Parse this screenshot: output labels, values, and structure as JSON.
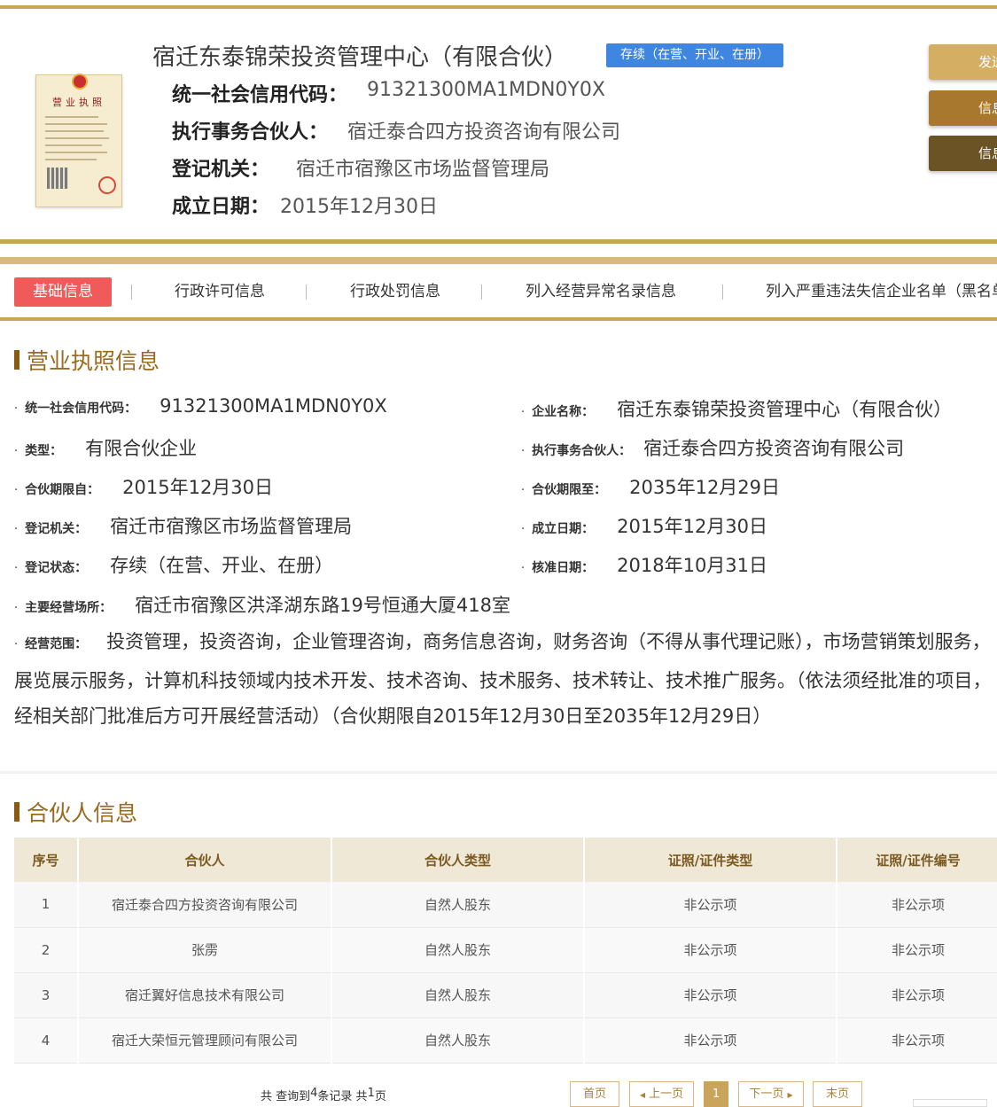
{
  "header": {
    "company_name": "宿迁东泰锦荣投资管理中心（有限合伙）",
    "status_tag": "存续（在营、开业、在册）",
    "rows": [
      {
        "key": "统一社会信用代码：",
        "value": "91321300MA1MDN0Y0X"
      },
      {
        "key": "执行事务合伙人：",
        "value": "宿迁泰合四方投资咨询有限公司"
      },
      {
        "key": "登记机关：",
        "value": "宿迁市宿豫区市场监督管理局"
      },
      {
        "key": "成立日期：",
        "value": "2015年12月30日"
      }
    ],
    "license_title": "营业执照",
    "side_buttons": [
      "发送",
      "信息",
      "信息"
    ],
    "side_colors": [
      "#d4ae63",
      "#a8782e",
      "#6b5326"
    ]
  },
  "tabs": {
    "active": "基础信息",
    "items": [
      "行政许可信息",
      "行政处罚信息",
      "列入经营异常名录信息",
      "列入严重违法失信企业名单（黑名单）"
    ]
  },
  "license_section": {
    "title": "营业执照信息",
    "fields": {
      "credit_code": {
        "label": "统一社会信用代码：",
        "value": "91321300MA1MDN0Y0X"
      },
      "name": {
        "label": "企业名称：",
        "value": "宿迁东泰锦荣投资管理中心（有限合伙）"
      },
      "type": {
        "label": "类型：",
        "value": "有限合伙企业"
      },
      "partner": {
        "label": "执行事务合伙人：",
        "value": "宿迁泰合四方投资咨询有限公司"
      },
      "term_from": {
        "label": "合伙期限自：",
        "value": "2015年12月30日"
      },
      "term_to": {
        "label": "合伙期限至：",
        "value": "2035年12月29日"
      },
      "authority": {
        "label": "登记机关：",
        "value": "宿迁市宿豫区市场监督管理局"
      },
      "established": {
        "label": "成立日期：",
        "value": "2015年12月30日"
      },
      "status": {
        "label": "登记状态：",
        "value": "存续（在营、开业、在册）"
      },
      "approved": {
        "label": "核准日期：",
        "value": "2018年10月31日"
      },
      "address": {
        "label": "主要经营场所：",
        "value": "宿迁市宿豫区洪泽湖东路19号恒通大厦418室"
      },
      "scope_label": "经营范围：",
      "scope_value": "投资管理，投资咨询，企业管理咨询，商务信息咨询，财务咨询（不得从事代理记账），市场营销策划服务，展览展示服务，计算机科技领域内技术开发、技术咨询、技术服务、技术转让、技术推广服务。（依法须经批准的项目，经相关部门批准后方可开展经营活动）（合伙期限自2015年12月30日至2035年12月29日）"
    }
  },
  "partner_section": {
    "title": "合伙人信息",
    "columns": [
      "序号",
      "合伙人",
      "合伙人类型",
      "证照/证件类型",
      "证照/证件编号"
    ],
    "rows": [
      [
        "1",
        "宿迁泰合四方投资咨询有限公司",
        "自然人股东",
        "非公示项",
        "非公示项"
      ],
      [
        "2",
        "张雳",
        "自然人股东",
        "非公示项",
        "非公示项"
      ],
      [
        "3",
        "宿迁翼好信息技术有限公司",
        "自然人股东",
        "非公示项",
        "非公示项"
      ],
      [
        "4",
        "宿迁大荣恒元管理顾问有限公司",
        "自然人股东",
        "非公示项",
        "非公示项"
      ]
    ]
  },
  "pagination": {
    "summary_prefix": "共 查询到 ",
    "count": "4",
    "summary_mid": " 条记录 共 ",
    "pages": "1",
    "summary_suffix": " 页",
    "first": "首页",
    "prev": "上一页",
    "current": "1",
    "next": "下一页",
    "last": "末页"
  }
}
